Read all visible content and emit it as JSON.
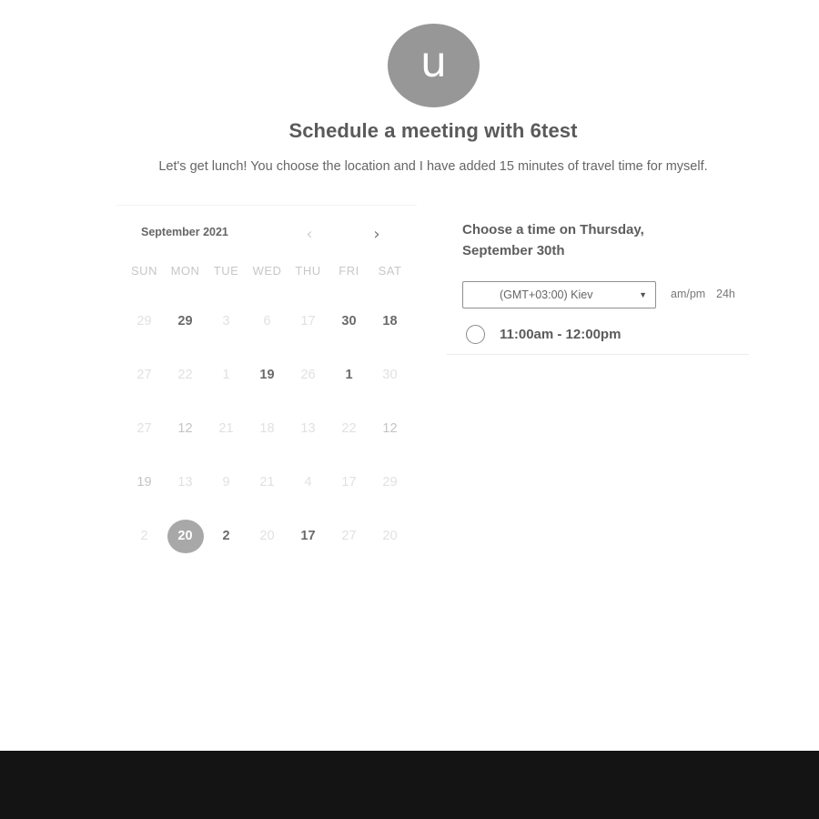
{
  "header": {
    "avatar_initial": "u",
    "title": "Schedule a meeting with 6test",
    "description": "Let's get lunch! You choose the location and I have added 15 minutes of travel time for myself."
  },
  "calendar": {
    "month_label": "September 2021",
    "prev_icon": "chevron-left-icon",
    "next_icon": "chevron-right-icon",
    "prev_glyph": "‹",
    "next_glyph": "›",
    "weekdays": [
      "SUN",
      "MON",
      "TUE",
      "WED",
      "THU",
      "FRI",
      "SAT"
    ],
    "weeks": [
      [
        {
          "label": "29",
          "state": "inactive"
        },
        {
          "label": "29",
          "state": "available"
        },
        {
          "label": "3",
          "state": "inactive"
        },
        {
          "label": "6",
          "state": "inactive"
        },
        {
          "label": "17",
          "state": "inactive"
        },
        {
          "label": "30",
          "state": "available"
        },
        {
          "label": "18",
          "state": "available"
        }
      ],
      [
        {
          "label": "27",
          "state": "inactive"
        },
        {
          "label": "22",
          "state": "inactive"
        },
        {
          "label": "1",
          "state": "inactive"
        },
        {
          "label": "19",
          "state": "available"
        },
        {
          "label": "26",
          "state": "inactive"
        },
        {
          "label": "1",
          "state": "available"
        },
        {
          "label": "30",
          "state": "inactive"
        }
      ],
      [
        {
          "label": "27",
          "state": "inactive"
        },
        {
          "label": "12",
          "state": "muted"
        },
        {
          "label": "21",
          "state": "inactive"
        },
        {
          "label": "18",
          "state": "inactive"
        },
        {
          "label": "13",
          "state": "inactive"
        },
        {
          "label": "22",
          "state": "inactive"
        },
        {
          "label": "12",
          "state": "muted"
        }
      ],
      [
        {
          "label": "19",
          "state": "muted"
        },
        {
          "label": "13",
          "state": "inactive"
        },
        {
          "label": "9",
          "state": "inactive"
        },
        {
          "label": "21",
          "state": "inactive"
        },
        {
          "label": "4",
          "state": "inactive"
        },
        {
          "label": "17",
          "state": "inactive"
        },
        {
          "label": "29",
          "state": "inactive"
        }
      ],
      [
        {
          "label": "2",
          "state": "inactive"
        },
        {
          "label": "20",
          "state": "selected"
        },
        {
          "label": "2",
          "state": "available"
        },
        {
          "label": "20",
          "state": "inactive"
        },
        {
          "label": "17",
          "state": "available"
        },
        {
          "label": "27",
          "state": "inactive"
        },
        {
          "label": "20",
          "state": "inactive"
        }
      ]
    ]
  },
  "times": {
    "heading": "Choose a time on Thursday, September 30th",
    "timezone_value": "(GMT+03:00) Kiev",
    "timezone_caret": "▼",
    "format_ampm": "am/pm",
    "format_24h": "24h",
    "slots": [
      {
        "label": "11:00am - 12:00pm"
      }
    ]
  },
  "colors": {
    "avatar_bg": "#979797",
    "selected_day_bg": "#a8a8a8",
    "footer_bg": "#141414"
  }
}
